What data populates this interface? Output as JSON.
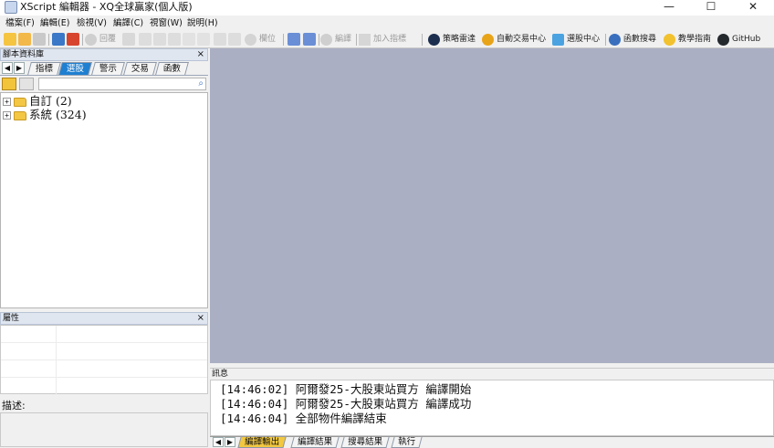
{
  "titlebar": {
    "title": "XScript 編輯器 - XQ全球贏家(個人版)",
    "minimize": "—",
    "maximize": "☐",
    "close": "✕"
  },
  "menu": [
    "檔案(F)",
    "編輯(E)",
    "檢視(V)",
    "編譯(C)",
    "視窗(W)",
    "說明(H)"
  ],
  "toolbar": {
    "recompile": "回覆",
    "position": "欄位",
    "compile": "編譯",
    "add_indicator": "加入指標",
    "strategy_radar": "策略雷達",
    "auto_trade": "自動交易中心",
    "stock_picker": "選股中心",
    "function_search": "函數搜尋",
    "tutorial": "教學指南",
    "github": "GitHub"
  },
  "left_panel": {
    "header": "腳本資料庫",
    "close": "×",
    "tabs": [
      "指標",
      "選股",
      "警示",
      "交易",
      "函數"
    ],
    "active_tab": "選股",
    "search_placeholder": "",
    "tree": [
      {
        "label": "自訂 (2)"
      },
      {
        "label": "系統 (324)"
      }
    ]
  },
  "properties": {
    "header": "屬性",
    "close": "×"
  },
  "description": {
    "label": "描述:"
  },
  "messages": {
    "header": "訊息",
    "lines": [
      "[14:46:02] 阿爾發25-大股東站買方 編譯開始",
      "[14:46:04] 阿爾發25-大股東站買方 編譯成功",
      "[14:46:04] 全部物件編譯結束"
    ],
    "tabs": [
      "編譯輸出",
      "編譯結果",
      "搜尋結果",
      "執行"
    ],
    "active_tab": "編譯輸出"
  }
}
